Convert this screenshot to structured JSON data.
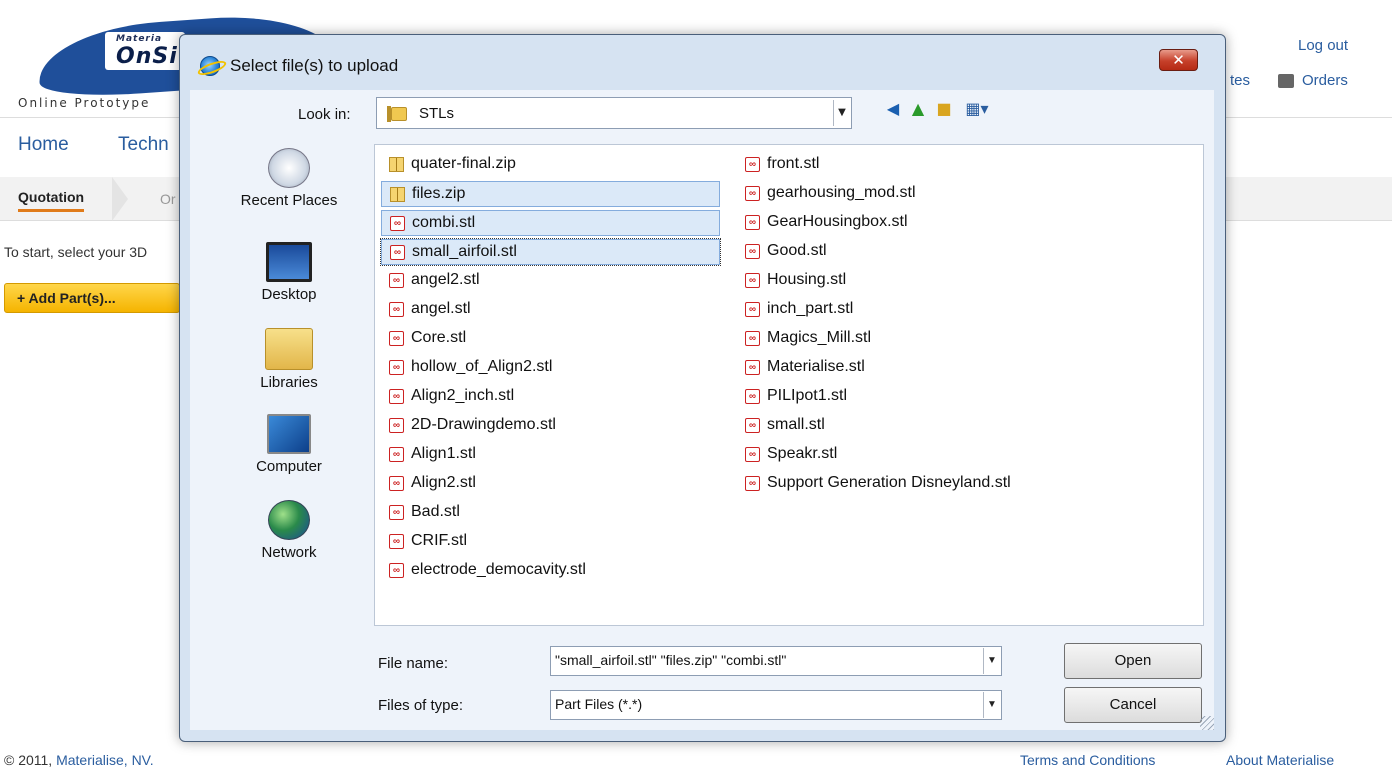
{
  "page": {
    "logo_small": "Materia",
    "logo_big": "OnSi",
    "tagline": "Online Prototype",
    "top_links": {
      "logout": "Log out",
      "quotes": "tes",
      "orders": "Orders"
    },
    "nav": [
      "Home",
      "Techn"
    ],
    "breadcrumb": {
      "active": "Quotation",
      "next": "Or"
    },
    "intro": "To start, select your 3D",
    "add_parts": "+ Add Part(s)...",
    "footer": {
      "copyright": "© 2011, ",
      "company": "Materialise, NV.",
      "terms": "Terms and Conditions",
      "about": "About Materialise"
    }
  },
  "dialog": {
    "title": "Select file(s) to upload",
    "close": "✕",
    "look_in_label": "Look in:",
    "look_in_value": "STLs",
    "places": [
      "Recent Places",
      "Desktop",
      "Libraries",
      "Computer",
      "Network"
    ],
    "files_col1": [
      {
        "name": "quater-final.zip",
        "type": "zip"
      },
      {
        "name": "files.zip",
        "type": "zip",
        "selected": true
      },
      {
        "name": "combi.stl",
        "type": "stl",
        "selected": true
      },
      {
        "name": "small_airfoil.stl",
        "type": "stl",
        "selected": true,
        "focused": true
      },
      {
        "name": "angel2.stl",
        "type": "stl"
      },
      {
        "name": "angel.stl",
        "type": "stl"
      },
      {
        "name": "Core.stl",
        "type": "stl"
      },
      {
        "name": "hollow_of_Align2.stl",
        "type": "stl"
      },
      {
        "name": "Align2_inch.stl",
        "type": "stl"
      },
      {
        "name": "2D-Drawingdemo.stl",
        "type": "stl"
      },
      {
        "name": "Align1.stl",
        "type": "stl"
      },
      {
        "name": "Align2.stl",
        "type": "stl"
      },
      {
        "name": "Bad.stl",
        "type": "stl"
      },
      {
        "name": "CRIF.stl",
        "type": "stl"
      },
      {
        "name": "electrode_democavity.stl",
        "type": "stl"
      }
    ],
    "files_col2": [
      {
        "name": "front.stl",
        "type": "stl"
      },
      {
        "name": "gearhousing_mod.stl",
        "type": "stl"
      },
      {
        "name": "GearHousingbox.stl",
        "type": "stl"
      },
      {
        "name": "Good.stl",
        "type": "stl"
      },
      {
        "name": "Housing.stl",
        "type": "stl"
      },
      {
        "name": "inch_part.stl",
        "type": "stl"
      },
      {
        "name": "Magics_Mill.stl",
        "type": "stl"
      },
      {
        "name": "Materialise.stl",
        "type": "stl"
      },
      {
        "name": "PILIpot1.stl",
        "type": "stl"
      },
      {
        "name": "small.stl",
        "type": "stl"
      },
      {
        "name": "Speakr.stl",
        "type": "stl"
      },
      {
        "name": "Support Generation Disneyland.stl",
        "type": "stl"
      }
    ],
    "file_name_label": "File name:",
    "file_name_value": "\"small_airfoil.stl\" \"files.zip\" \"combi.stl\"",
    "file_type_label": "Files of type:",
    "file_type_value": "Part Files (*.*)",
    "open": "Open",
    "cancel": "Cancel"
  }
}
